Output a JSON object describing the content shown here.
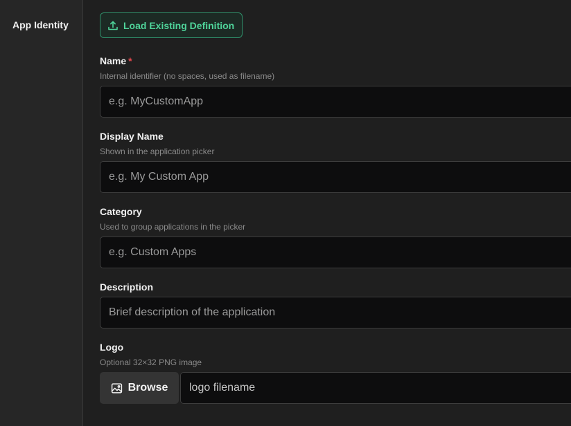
{
  "sidebar": {
    "items": [
      {
        "label": "App Identity"
      }
    ]
  },
  "toolbar": {
    "load_label": "Load Existing Definition",
    "load_icon": "upload-icon"
  },
  "form": {
    "name": {
      "label": "Name",
      "required_mark": "*",
      "help": "Internal identifier (no spaces, used as filename)",
      "value": "",
      "placeholder": "e.g. MyCustomApp"
    },
    "display_name": {
      "label": "Display Name",
      "help": "Shown in the application picker",
      "value": "",
      "placeholder": "e.g. My Custom App"
    },
    "category": {
      "label": "Category",
      "help": "Used to group applications in the picker",
      "value": "",
      "placeholder": "e.g. Custom Apps"
    },
    "description": {
      "label": "Description",
      "value": "",
      "placeholder": "Brief description of the application"
    },
    "logo": {
      "label": "Logo",
      "help": "Optional 32×32 PNG image",
      "browse_label": "Browse",
      "browse_icon": "image-icon",
      "value": "",
      "placeholder": "logo filename"
    }
  },
  "colors": {
    "accent": "#4fd49a",
    "required": "#e5484d",
    "background": "#1f1f1f",
    "sidebar": "#262626"
  }
}
